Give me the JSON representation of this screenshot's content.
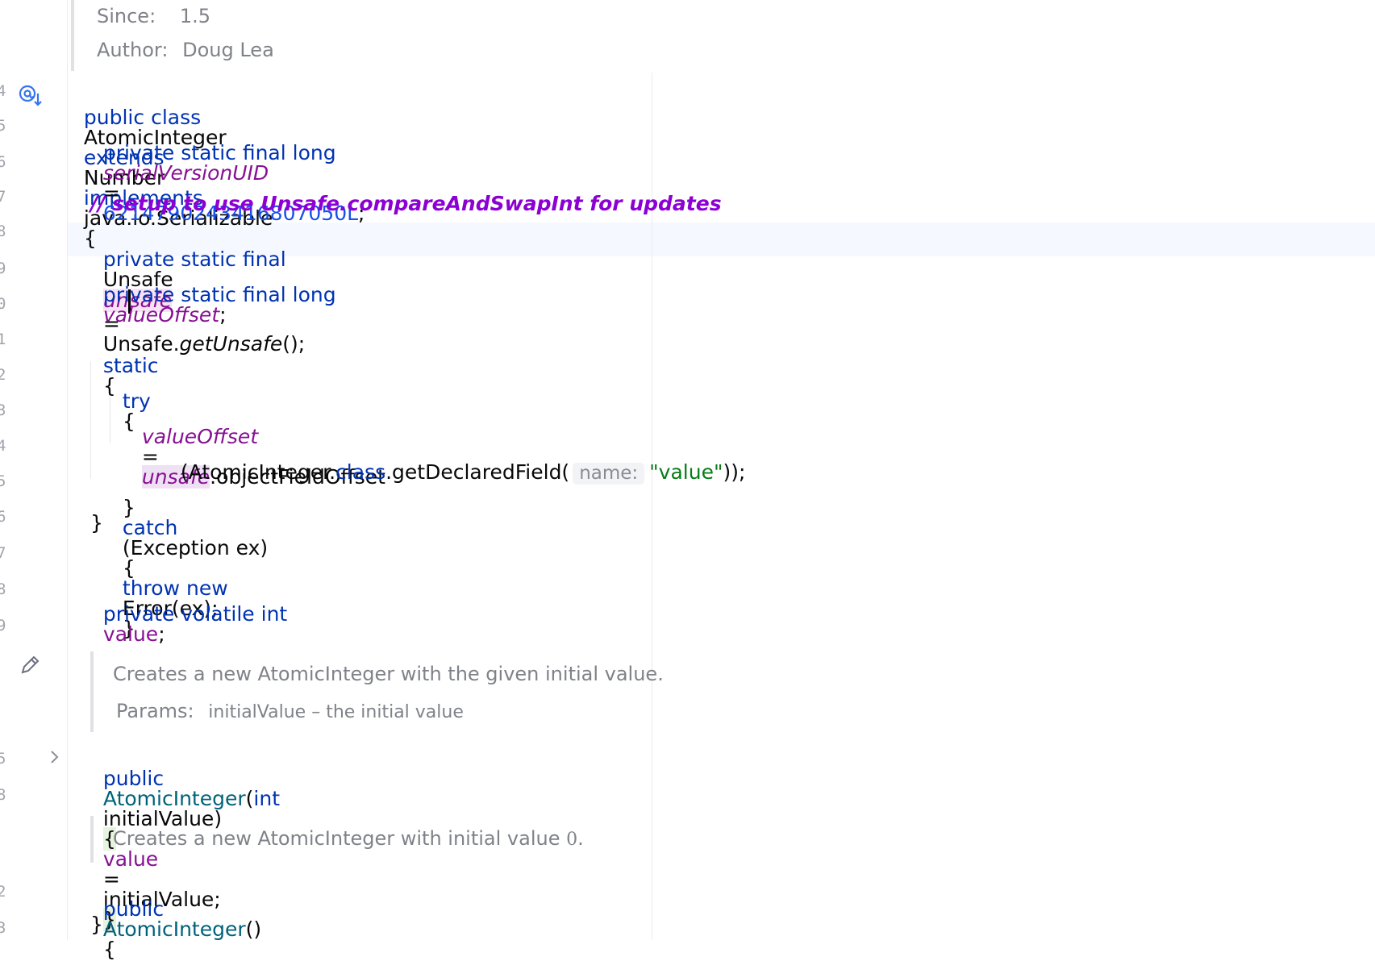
{
  "doc_header": {
    "since_label": "Since:",
    "since_value": "1.5",
    "author_label": "Author:",
    "author_value": "Doug Lea"
  },
  "line_numbers": [
    "4",
    "5",
    "6",
    "7",
    "8",
    "9",
    "0",
    "1",
    "2",
    "3",
    "4",
    "5",
    "6",
    "7",
    "8",
    "9",
    "5",
    "8",
    "2",
    "3"
  ],
  "code": {
    "class_decl": {
      "kw1": "public class",
      "name": "AtomicInteger",
      "kw2": "extends",
      "super": "Number",
      "kw3": "implements",
      "iface": "java.io.Serializable",
      "brace": "{"
    },
    "serial": {
      "kw": "private static final long",
      "field": "serialVersionUID",
      "eq": "=",
      "value": "6214790243416807050L",
      "semi": ";"
    },
    "comment": "// setup to use Unsafe.compareAndSwapInt for updates",
    "unsafe_decl": {
      "kw": "private static final",
      "type": "Unsafe",
      "field_a": "un",
      "field_b": "safe",
      "eq": "=",
      "cls": "Unsafe.",
      "meth": "getUnsafe",
      "end": "();"
    },
    "offset_decl": {
      "kw": "private static final long",
      "field": "valueOffset",
      "semi": ";"
    },
    "static_block": {
      "kw": "static",
      "brace": "{"
    },
    "try_line": {
      "kw": "try",
      "brace": "{"
    },
    "assign_line": {
      "field": "valueOffset",
      "eq": "=",
      "target": "unsafe",
      "call": ".objectFieldOffset"
    },
    "getfield_line": {
      "open": "(AtomicInteger.",
      "kw": "class",
      "call": ".getDeclaredField(",
      "hint": "name:",
      "str": "\"value\"",
      "close": "));"
    },
    "catch_line": {
      "close": "}",
      "kw_catch": "catch",
      "params": "(Exception ex)",
      "open": "{",
      "kw_throw": "throw new",
      "rest": "Error(ex);",
      "end": "}"
    },
    "static_close": "}",
    "value_decl": {
      "kw": "private volatile int",
      "field": "value",
      "semi": ";"
    },
    "ctor1": {
      "kw": "public",
      "name": "AtomicInteger",
      "open_paren": "(",
      "ptype": "int",
      "pname": "initialValue",
      "close_paren": ")",
      "open_brace": "{",
      "field": "value",
      "eq": "=",
      "rhs": "initialValue;",
      "close_brace": "}"
    },
    "ctor2": {
      "kw": "public",
      "name": "AtomicInteger",
      "parens": "()",
      "brace": "{"
    },
    "ctor2_close": "}"
  },
  "javadoc1": {
    "text": "Creates a new AtomicInteger with the given initial value.",
    "params_label": "Params:",
    "params_value": "initialValue – the initial value"
  },
  "javadoc2": {
    "text": "Creates a new AtomicInteger with initial value",
    "zero": "0",
    "period": "."
  },
  "gutter_icons": {
    "implemented_icon": "implemented-by-icon",
    "edit_icon": "pencil-icon",
    "fold_icon": "chevron-right-icon"
  }
}
